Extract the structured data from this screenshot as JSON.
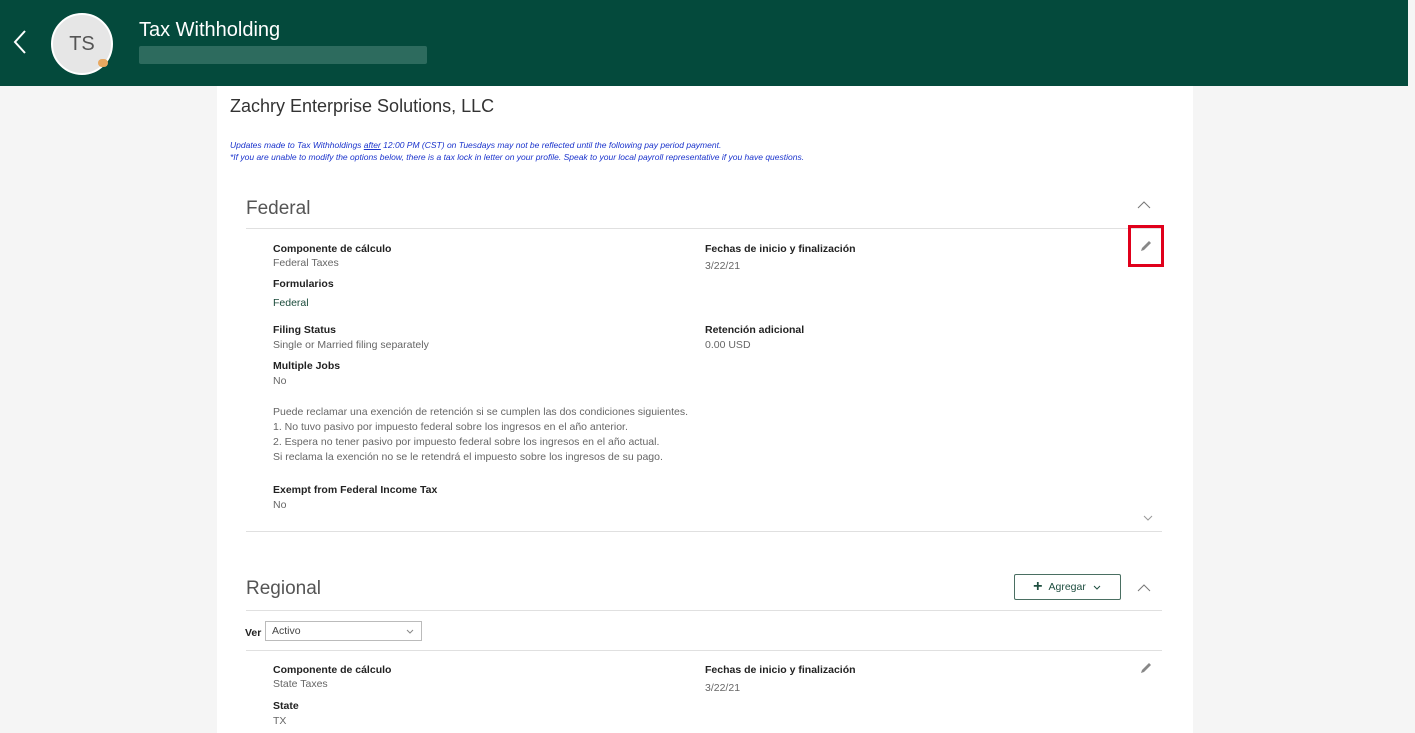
{
  "header": {
    "title": "Tax Withholding",
    "avatar_initials": "TS",
    "back_icon": "chevron-left-icon"
  },
  "company": "Zachry Enterprise Solutions, LLC",
  "notice": {
    "line1_before": "Updates made to Tax Withholdings ",
    "line1_emph": "after",
    "line1_after": " 12:00 PM (CST) on Tuesdays may not be reflected until the following pay period payment.",
    "line2": "*If you are unable to modify the options below, there is a tax lock in letter on your profile. Speak to your local payroll representative if you have questions."
  },
  "federal": {
    "title": "Federal",
    "component_label": "Componente de cálculo",
    "component_value": "Federal Taxes",
    "dates_label": "Fechas de inicio y finalización",
    "dates_value": "3/22/21",
    "forms_label": "Formularios",
    "forms_value": "Federal",
    "filing_label": "Filing Status",
    "filing_value": "Single or Married filing separately",
    "additional_label": "Retención adicional",
    "additional_value": "0.00 USD",
    "multiple_label": "Multiple Jobs",
    "multiple_value": "No",
    "exemption_text": [
      "Puede reclamar una exención de retención si se cumplen las dos condiciones siguientes.",
      " 1. No tuvo pasivo por impuesto federal sobre los ingresos en el año anterior.",
      " 2. Espera no tener pasivo por impuesto federal sobre los ingresos en el año actual.",
      "Si reclama la exención no se le retendrá el impuesto sobre los ingresos de su pago."
    ],
    "exempt_label": "Exempt from Federal Income Tax",
    "exempt_value": "No"
  },
  "regional": {
    "title": "Regional",
    "add_label": "Agregar",
    "view_label": "Ver",
    "view_value": "Activo",
    "component_label": "Componente de cálculo",
    "component_value": "State Taxes",
    "dates_label": "Fechas de inicio y finalización",
    "dates_value": "3/22/21",
    "state_label": "State",
    "state_value": "TX"
  },
  "colors": {
    "header_bg": "#044a3c",
    "highlight": "#e0001b",
    "notice_text": "#1a33cc"
  }
}
